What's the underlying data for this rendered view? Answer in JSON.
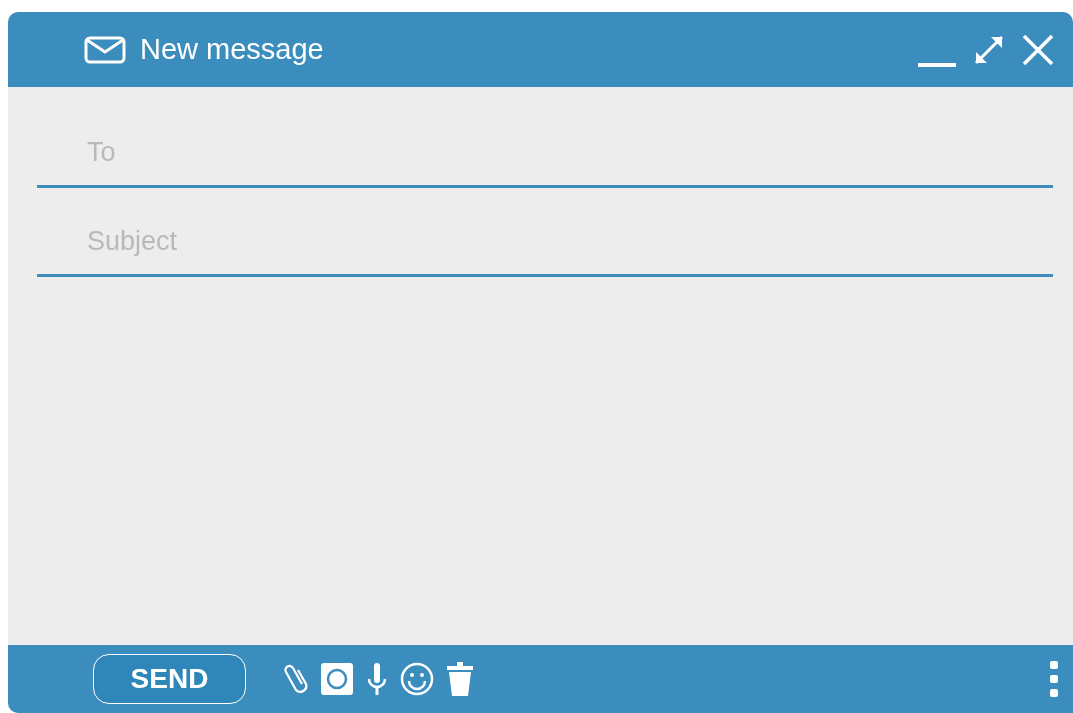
{
  "window": {
    "title": "New message"
  },
  "fields": [
    {
      "placeholder": "To"
    },
    {
      "placeholder": "Subject"
    }
  ],
  "footer": {
    "send_button": "SEND"
  }
}
